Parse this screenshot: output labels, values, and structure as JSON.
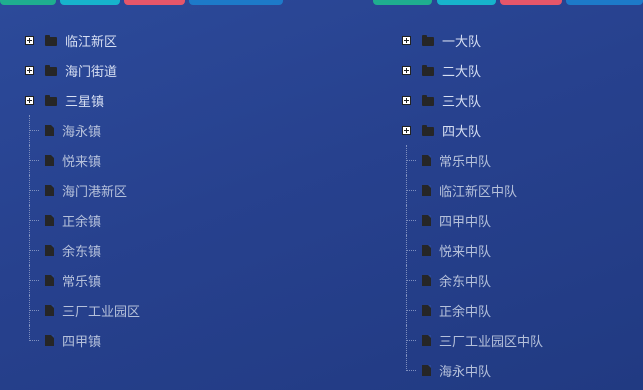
{
  "colors": {
    "background": "#27418e",
    "tab_teal": "#1fae8f",
    "tab_cyan": "#17b3cc",
    "tab_red": "#e5566a",
    "tab_blue": "#1d7ac9"
  },
  "icons": {
    "expand": "plus-box-icon",
    "folder": "folder-icon",
    "file": "file-icon"
  },
  "left_tree": {
    "folders": [
      {
        "label": "临江新区"
      },
      {
        "label": "海门街道"
      },
      {
        "label": "三星镇"
      }
    ],
    "children": [
      {
        "label": "海永镇"
      },
      {
        "label": "悦来镇"
      },
      {
        "label": "海门港新区"
      },
      {
        "label": "正余镇"
      },
      {
        "label": "余东镇"
      },
      {
        "label": "常乐镇"
      },
      {
        "label": "三厂工业园区"
      },
      {
        "label": "四甲镇"
      }
    ]
  },
  "right_tree": {
    "folders": [
      {
        "label": "一大队"
      },
      {
        "label": "二大队"
      },
      {
        "label": "三大队"
      },
      {
        "label": "四大队"
      }
    ],
    "children": [
      {
        "label": "常乐中队"
      },
      {
        "label": "临江新区中队"
      },
      {
        "label": "四甲中队"
      },
      {
        "label": "悦来中队"
      },
      {
        "label": "余东中队"
      },
      {
        "label": "正余中队"
      },
      {
        "label": "三厂工业园区中队"
      },
      {
        "label": "海永中队"
      }
    ]
  }
}
